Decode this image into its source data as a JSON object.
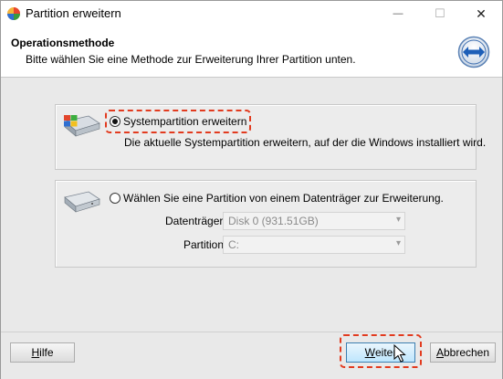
{
  "window": {
    "title": "Partition erweitern",
    "minimize_glyph": "—",
    "maximize_glyph": "☐",
    "close_glyph": "✕"
  },
  "header": {
    "title": "Operationsmethode",
    "subtitle": "Bitte wählen Sie eine Methode zur Erweiterung Ihrer Partition unten.",
    "icon": "arrows-resize-icon"
  },
  "options": [
    {
      "label": "Systempartition erweitern",
      "description": "Die aktuelle Systempartition erweitern, auf der die Windows installiert wird.",
      "selected": true,
      "icon": "disk-icon"
    },
    {
      "label": "Wählen Sie eine Partition von einem Datenträger zur Erweiterung.",
      "selected": false,
      "icon": "disk-icon",
      "fields": {
        "disk_label": "Datenträger",
        "disk_value": "Disk 0 (931.51GB)",
        "partition_label": "Partition",
        "partition_value": "C:"
      }
    }
  ],
  "footer": {
    "help_hotkey": "H",
    "help_rest": "ilfe",
    "next_hotkey": "W",
    "next_rest": "eiter",
    "cancel_hotkey": "A",
    "cancel_rest": "bbrechen"
  },
  "colors": {
    "highlight": "#e23b1f",
    "accent": "#3c7fb1"
  }
}
